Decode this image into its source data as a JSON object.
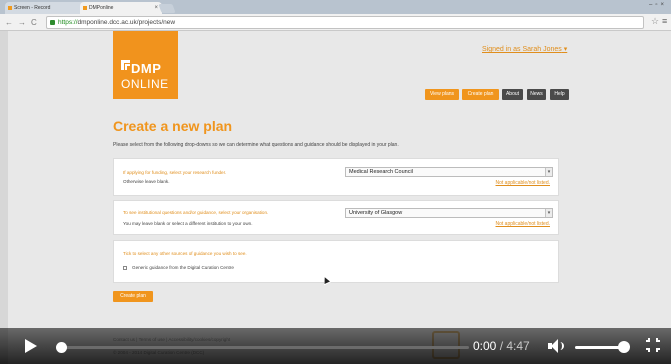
{
  "browser": {
    "tabs": [
      {
        "label": "Screen - Record"
      },
      {
        "label": "DMPonline"
      }
    ],
    "url_https": "https://",
    "url_rest": "dmponline.dcc.ac.uk/projects/new"
  },
  "header": {
    "logo_line1": "DMP",
    "logo_line2": "ONLINE",
    "signed_in": "Signed in as Sarah Jones",
    "nav": [
      "View plans",
      "Create plan",
      "About",
      "News",
      "Help"
    ]
  },
  "main": {
    "title": "Create a new plan",
    "intro": "Please select from the following drop-downs so we can determine what questions and guidance should be displayed in your plan.",
    "funder": {
      "label": "If applying for funding, select your research funder.",
      "sub": "Otherwise leave blank.",
      "value": "Medical Research Council",
      "not_applicable": "Not applicable/not listed."
    },
    "organisation": {
      "label": "To see institutional questions and/or guidance, select your organisation.",
      "sub": "You may leave blank or select a different institution to your own.",
      "value": "University of Glasgow",
      "not_applicable": "Not applicable/not listed."
    },
    "guidance": {
      "label": "Tick to select any other sources of guidance you wish to see.",
      "option": "Generic guidance from the Digital Curation Centre"
    },
    "create_button": "Create plan"
  },
  "footer": {
    "links": "Contact us  |  Terms of use  |  Accessibility/cookies/copyright",
    "copyright": "© 2004 - 2014 Digital Curation Centre (DCC)"
  },
  "player": {
    "current_time": "0:00",
    "separator": " / ",
    "duration": "4:47",
    "progress": 0,
    "volume": 1.0
  },
  "colors": {
    "accent": "#f0951d",
    "dark_button": "#4a4a4a"
  }
}
